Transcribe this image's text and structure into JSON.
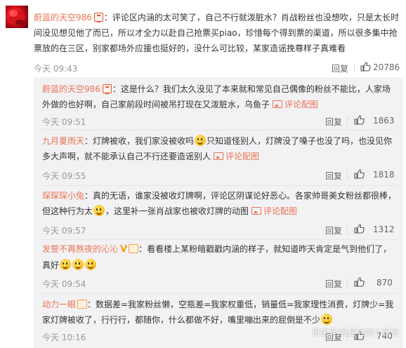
{
  "top_comment": {
    "username": "蔚蓝的天空986",
    "text": "：评论区内涵的太可笑了，自己不行就泼脏水？肖战粉丝也没想吹，只是太长时间没见想见他了而已，所以才全力以赴自己抢票买piao，珍惜每个得到票的渠道，所以很多集中抢票放的在三区，别家都场外应援也挺好的，没什么可比较，某家造谣挽尊样子真难看",
    "time": "今天 09:43",
    "reply_label": "回复",
    "likes": "20786"
  },
  "replies": [
    {
      "username": "蔚蓝的天空986",
      "text": "：这是什么？我们太久没见了本来就和常见自己偶像的粉丝不能比，人家场外做的也好啊，自己家前段时间被吊打现在又泼脏水，乌鱼子",
      "link": "评论配图",
      "time": "今天 09:51",
      "reply_label": "回复",
      "likes": "1863"
    },
    {
      "username": "九月夏雨天",
      "text_a": "：灯牌被收，我们家没被收吗",
      "text_b": "只知道怪别人，灯牌没了嗓子也没了吗，也没见你多大声啊，就不能承认自己不行还要造谣别人",
      "link": "评论配图",
      "time": "今天 09:55",
      "reply_label": "回复",
      "likes": "1818"
    },
    {
      "username": "琛琛琛小兔",
      "text_a": "：真的无语，谁家没被收灯牌啊，评论区阴谋论好恶心。各家帅哥美女粉丝都很棒，但这种行为太",
      "text_b": "，这里补一张肖战家也被收灯牌的动图",
      "link": "评论配图",
      "time": "今天 09:57",
      "reply_label": "回复",
      "likes": "1312"
    },
    {
      "username": "发誓不再熬夜的沁沁",
      "text": "：看看楼上某粉暗戳戳内涵的样子，就知道昨天肯定是气到他们了，真好",
      "time": "今天 09:54",
      "reply_label": "回复",
      "likes": "870"
    },
    {
      "username": "动力一眼",
      "text": "：数据差=我家粉丝懒，空瓶差=我家权重低，销量低=我家理性消费，灯牌少=我家灯牌被收了，行行行，都随你，什么都做不好，嘴里嘣出来的屁倒是不少",
      "time": "今天 10:16",
      "reply_label": "回复",
      "likes": "740"
    }
  ],
  "watermark": "百家号/我是独家小哥哥",
  "icons": {
    "badge": "red-badge-icon",
    "thumb": "thumbs-up-icon",
    "image": "image-icon",
    "vip": "vip-crown-icon"
  }
}
